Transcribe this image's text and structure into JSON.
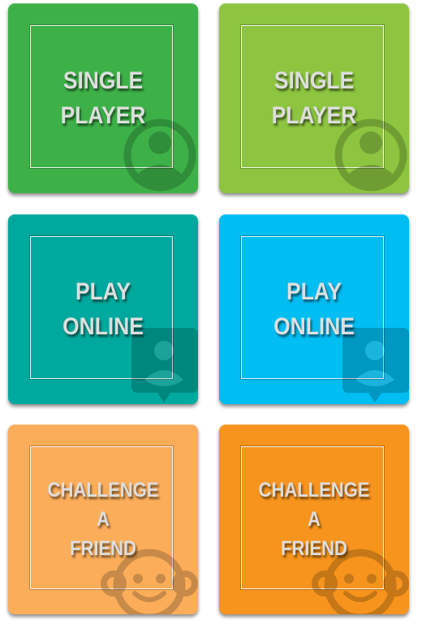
{
  "tiles": [
    {
      "id": "single-player-green",
      "lines": [
        "SINGLE",
        "PLAYER"
      ],
      "color": "#3db148",
      "icon": "person-circle-icon"
    },
    {
      "id": "single-player-lime",
      "lines": [
        "SINGLE",
        "PLAYER"
      ],
      "color": "#8dc540",
      "icon": "person-circle-icon"
    },
    {
      "id": "play-online-teal",
      "lines": [
        "PLAY",
        "ONLINE"
      ],
      "color": "#00a99d",
      "icon": "person-chat-bubble-icon"
    },
    {
      "id": "play-online-blue",
      "lines": [
        "PLAY",
        "ONLINE"
      ],
      "color": "#00bdf2",
      "icon": "person-chat-bubble-icon"
    },
    {
      "id": "challenge-friend-peach",
      "lines": [
        "CHALLENGE",
        "A",
        "FRIEND"
      ],
      "color": "#fbad5a",
      "icon": "smiley-face-icon"
    },
    {
      "id": "challenge-friend-orange",
      "lines": [
        "CHALLENGE",
        "A",
        "FRIEND"
      ],
      "color": "#f7941d",
      "icon": "smiley-face-icon"
    }
  ]
}
